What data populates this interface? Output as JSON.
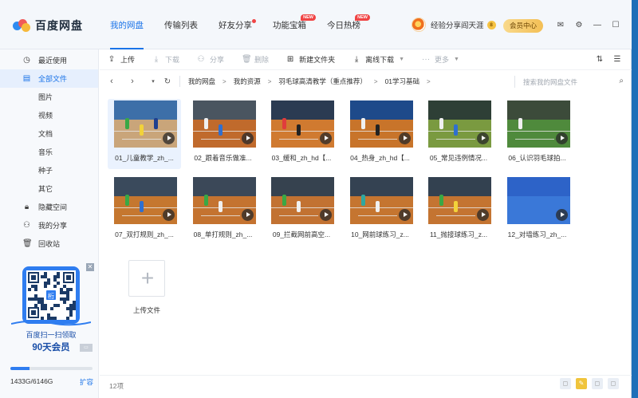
{
  "app": {
    "name": "百度网盘"
  },
  "nav": {
    "tabs": [
      {
        "label": "我的网盘"
      },
      {
        "label": "传输列表"
      },
      {
        "label": "好友分享"
      },
      {
        "label": "功能宝箱",
        "badge": "NEW"
      },
      {
        "label": "今日热榜",
        "badge": "NEW"
      }
    ]
  },
  "user": {
    "name": "经验分享阎天涯",
    "level": "8",
    "member_button": "会员中心"
  },
  "sidebar": {
    "items": [
      {
        "label": "最近使用",
        "icon": "clock-icon"
      },
      {
        "label": "全部文件",
        "icon": "document-icon"
      },
      {
        "label": "图片"
      },
      {
        "label": "视频"
      },
      {
        "label": "文档"
      },
      {
        "label": "音乐"
      },
      {
        "label": "种子"
      },
      {
        "label": "其它"
      },
      {
        "label": "隐藏空间",
        "icon": "lock-icon"
      },
      {
        "label": "我的分享",
        "icon": "share-icon"
      },
      {
        "label": "回收站",
        "icon": "trash-icon"
      }
    ]
  },
  "promo": {
    "line1": "百度扫一扫领取",
    "line2": "90天会员",
    "qr_center": "桁"
  },
  "storage": {
    "used": "1433G",
    "total": "6146G",
    "text": "1433G/6146G",
    "expand": "扩容",
    "fraction": 0.233
  },
  "toolbar": {
    "upload": "上传",
    "download": "下载",
    "share": "分享",
    "delete": "删除",
    "new_folder": "新建文件夹",
    "offline_download": "离线下载",
    "more": "更多"
  },
  "path": {
    "crumbs": [
      "我的网盘",
      "我的资源",
      "羽毛球高清教学（重点推荐）",
      "01学习基础"
    ],
    "search_placeholder": "搜索我的网盘文件"
  },
  "files": [
    {
      "name": "01_儿童教学_zh_..."
    },
    {
      "name": "02_跟着音乐做准..."
    },
    {
      "name": "03_缓和_zh_hd【..."
    },
    {
      "name": "04_热身_zh_hd【..."
    },
    {
      "name": "05_常见违例情况..."
    },
    {
      "name": "06_认识羽毛球拍..."
    },
    {
      "name": "07_双打规则_zh_..."
    },
    {
      "name": "08_单打规则_zh_..."
    },
    {
      "name": "09_拦截网前高空..."
    },
    {
      "name": "10_网前球练习_z..."
    },
    {
      "name": "11_抛接球练习_z..."
    },
    {
      "name": "12_对墙练习_zh_..."
    }
  ],
  "upload_tile": {
    "label": "上传文件"
  },
  "status": {
    "count": "12项"
  },
  "colors": {
    "accent": "#1a73e8",
    "promo_blue": "#2f7df0",
    "court_orange": "#c8742a"
  }
}
